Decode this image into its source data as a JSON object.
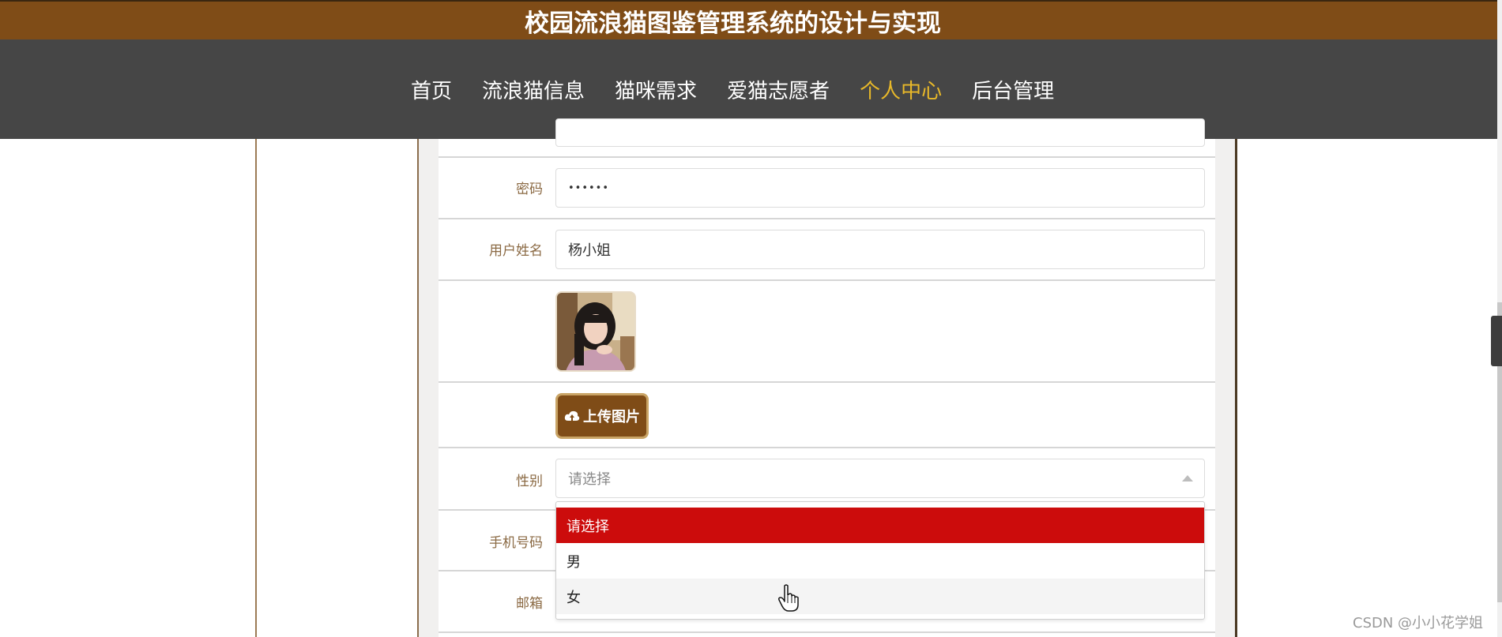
{
  "header": {
    "title": "校园流浪猫图鉴管理系统的设计与实现"
  },
  "nav": {
    "items": [
      {
        "label": "首页"
      },
      {
        "label": "流浪猫信息"
      },
      {
        "label": "猫咪需求"
      },
      {
        "label": "爱猫志愿者"
      },
      {
        "label": "个人中心"
      },
      {
        "label": "后台管理"
      }
    ],
    "active_index": 4,
    "active_color": "#e8b829"
  },
  "form": {
    "password": {
      "label": "密码",
      "value": "••••••"
    },
    "username": {
      "label": "用户姓名",
      "value": "杨小姐"
    },
    "avatar": {
      "icon": "avatar-photo"
    },
    "upload": {
      "label": "上传图片",
      "icon": "cloud-upload-icon"
    },
    "gender": {
      "label": "性别",
      "placeholder": "请选择",
      "options": [
        "请选择",
        "男",
        "女"
      ],
      "highlighted_index": 0,
      "hover_index": 2
    },
    "phone": {
      "label": "手机号码"
    },
    "email": {
      "label": "邮箱"
    }
  },
  "colors": {
    "title_bar": "#7f4c17",
    "nav_bar": "#464646",
    "label": "#8b6a44",
    "option_selected": "#cc0c0c"
  },
  "watermark": "CSDN @小小花学姐"
}
